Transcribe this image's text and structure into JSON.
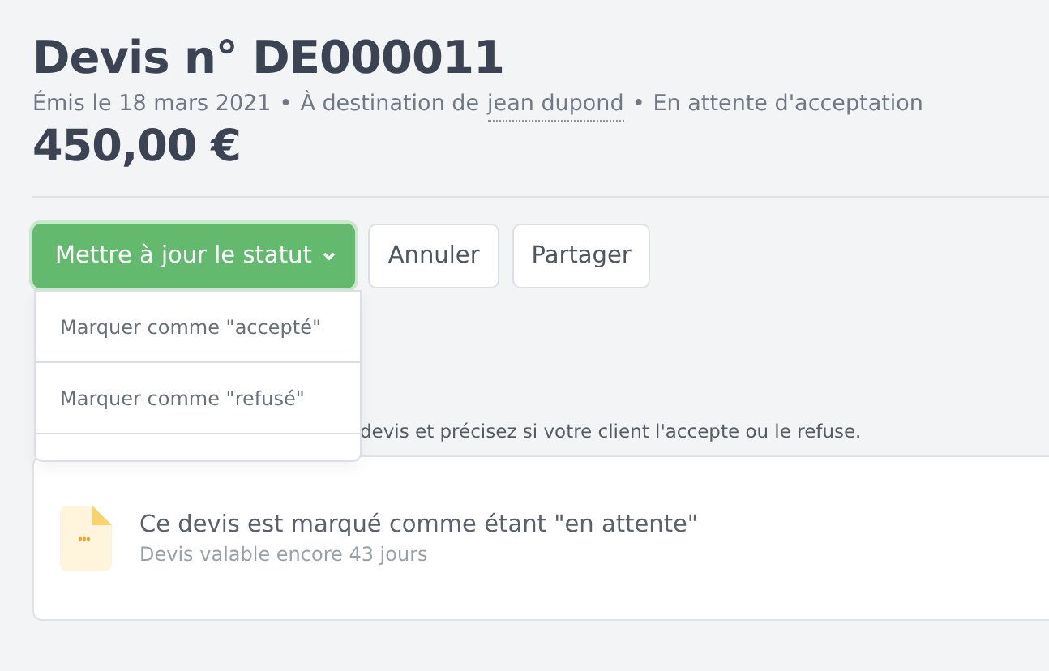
{
  "header": {
    "title": "Devis n° DE000011",
    "issued": "Émis le 18 mars 2021",
    "separator_1": "•",
    "recipient_prefix": "À destination de",
    "recipient": "jean dupond",
    "separator_2": "•",
    "status": "En attente d'acceptation",
    "amount": "450,00 €"
  },
  "actions": {
    "primary": "Mettre à jour le statut",
    "buttons": [
      "Annuler",
      "Partager"
    ]
  },
  "menu": {
    "items": [
      "Marquer comme \"accepté\"",
      "Marquer comme \"refusé\""
    ]
  },
  "hint": "devis et précisez si votre client l'accepte ou le refuse.",
  "status_card": {
    "title": "Ce devis est marqué comme étant \"en attente\"",
    "subtitle": "Devis valable encore 43 jours"
  }
}
